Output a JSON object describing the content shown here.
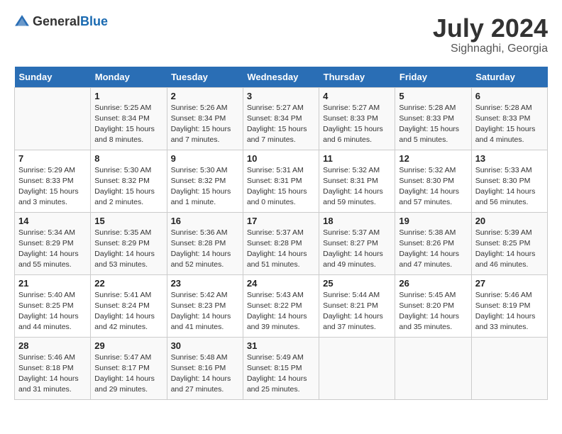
{
  "header": {
    "logo_general": "General",
    "logo_blue": "Blue",
    "month": "July 2024",
    "location": "Sighnaghi, Georgia"
  },
  "weekdays": [
    "Sunday",
    "Monday",
    "Tuesday",
    "Wednesday",
    "Thursday",
    "Friday",
    "Saturday"
  ],
  "weeks": [
    [
      {
        "day": "",
        "info": ""
      },
      {
        "day": "1",
        "info": "Sunrise: 5:25 AM\nSunset: 8:34 PM\nDaylight: 15 hours\nand 8 minutes."
      },
      {
        "day": "2",
        "info": "Sunrise: 5:26 AM\nSunset: 8:34 PM\nDaylight: 15 hours\nand 7 minutes."
      },
      {
        "day": "3",
        "info": "Sunrise: 5:27 AM\nSunset: 8:34 PM\nDaylight: 15 hours\nand 7 minutes."
      },
      {
        "day": "4",
        "info": "Sunrise: 5:27 AM\nSunset: 8:33 PM\nDaylight: 15 hours\nand 6 minutes."
      },
      {
        "day": "5",
        "info": "Sunrise: 5:28 AM\nSunset: 8:33 PM\nDaylight: 15 hours\nand 5 minutes."
      },
      {
        "day": "6",
        "info": "Sunrise: 5:28 AM\nSunset: 8:33 PM\nDaylight: 15 hours\nand 4 minutes."
      }
    ],
    [
      {
        "day": "7",
        "info": "Sunrise: 5:29 AM\nSunset: 8:33 PM\nDaylight: 15 hours\nand 3 minutes."
      },
      {
        "day": "8",
        "info": "Sunrise: 5:30 AM\nSunset: 8:32 PM\nDaylight: 15 hours\nand 2 minutes."
      },
      {
        "day": "9",
        "info": "Sunrise: 5:30 AM\nSunset: 8:32 PM\nDaylight: 15 hours\nand 1 minute."
      },
      {
        "day": "10",
        "info": "Sunrise: 5:31 AM\nSunset: 8:31 PM\nDaylight: 15 hours\nand 0 minutes."
      },
      {
        "day": "11",
        "info": "Sunrise: 5:32 AM\nSunset: 8:31 PM\nDaylight: 14 hours\nand 59 minutes."
      },
      {
        "day": "12",
        "info": "Sunrise: 5:32 AM\nSunset: 8:30 PM\nDaylight: 14 hours\nand 57 minutes."
      },
      {
        "day": "13",
        "info": "Sunrise: 5:33 AM\nSunset: 8:30 PM\nDaylight: 14 hours\nand 56 minutes."
      }
    ],
    [
      {
        "day": "14",
        "info": "Sunrise: 5:34 AM\nSunset: 8:29 PM\nDaylight: 14 hours\nand 55 minutes."
      },
      {
        "day": "15",
        "info": "Sunrise: 5:35 AM\nSunset: 8:29 PM\nDaylight: 14 hours\nand 53 minutes."
      },
      {
        "day": "16",
        "info": "Sunrise: 5:36 AM\nSunset: 8:28 PM\nDaylight: 14 hours\nand 52 minutes."
      },
      {
        "day": "17",
        "info": "Sunrise: 5:37 AM\nSunset: 8:28 PM\nDaylight: 14 hours\nand 51 minutes."
      },
      {
        "day": "18",
        "info": "Sunrise: 5:37 AM\nSunset: 8:27 PM\nDaylight: 14 hours\nand 49 minutes."
      },
      {
        "day": "19",
        "info": "Sunrise: 5:38 AM\nSunset: 8:26 PM\nDaylight: 14 hours\nand 47 minutes."
      },
      {
        "day": "20",
        "info": "Sunrise: 5:39 AM\nSunset: 8:25 PM\nDaylight: 14 hours\nand 46 minutes."
      }
    ],
    [
      {
        "day": "21",
        "info": "Sunrise: 5:40 AM\nSunset: 8:25 PM\nDaylight: 14 hours\nand 44 minutes."
      },
      {
        "day": "22",
        "info": "Sunrise: 5:41 AM\nSunset: 8:24 PM\nDaylight: 14 hours\nand 42 minutes."
      },
      {
        "day": "23",
        "info": "Sunrise: 5:42 AM\nSunset: 8:23 PM\nDaylight: 14 hours\nand 41 minutes."
      },
      {
        "day": "24",
        "info": "Sunrise: 5:43 AM\nSunset: 8:22 PM\nDaylight: 14 hours\nand 39 minutes."
      },
      {
        "day": "25",
        "info": "Sunrise: 5:44 AM\nSunset: 8:21 PM\nDaylight: 14 hours\nand 37 minutes."
      },
      {
        "day": "26",
        "info": "Sunrise: 5:45 AM\nSunset: 8:20 PM\nDaylight: 14 hours\nand 35 minutes."
      },
      {
        "day": "27",
        "info": "Sunrise: 5:46 AM\nSunset: 8:19 PM\nDaylight: 14 hours\nand 33 minutes."
      }
    ],
    [
      {
        "day": "28",
        "info": "Sunrise: 5:46 AM\nSunset: 8:18 PM\nDaylight: 14 hours\nand 31 minutes."
      },
      {
        "day": "29",
        "info": "Sunrise: 5:47 AM\nSunset: 8:17 PM\nDaylight: 14 hours\nand 29 minutes."
      },
      {
        "day": "30",
        "info": "Sunrise: 5:48 AM\nSunset: 8:16 PM\nDaylight: 14 hours\nand 27 minutes."
      },
      {
        "day": "31",
        "info": "Sunrise: 5:49 AM\nSunset: 8:15 PM\nDaylight: 14 hours\nand 25 minutes."
      },
      {
        "day": "",
        "info": ""
      },
      {
        "day": "",
        "info": ""
      },
      {
        "day": "",
        "info": ""
      }
    ]
  ]
}
